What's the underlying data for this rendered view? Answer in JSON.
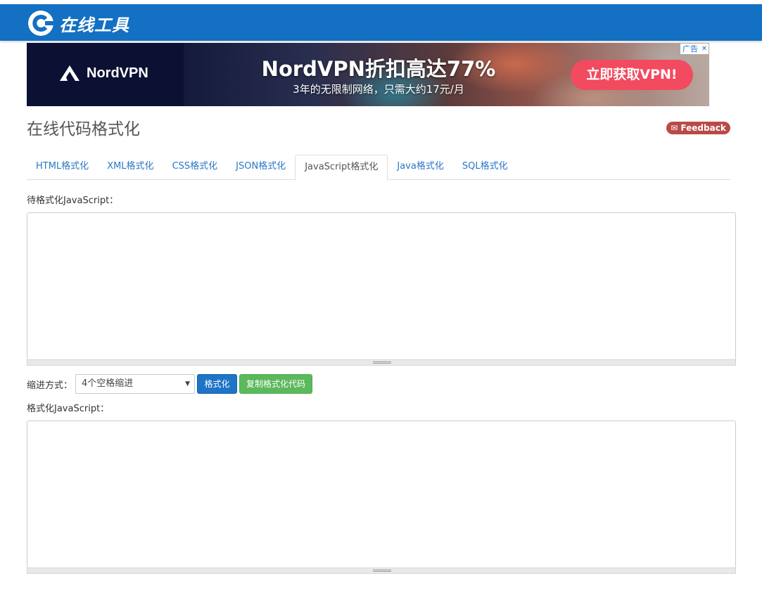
{
  "header": {
    "logo_text": "在线工具",
    "logo_icon": "c-logo-icon"
  },
  "ad": {
    "brand": "NordVPN",
    "headline": "NordVPN折扣高达77%",
    "subline": "3年的无限制网络，只需大约17元/月",
    "cta": "立即获取VPN!",
    "tag": "广告",
    "close": "✕"
  },
  "page": {
    "title": "在线代码格式化",
    "feedback_label": "✉ Feedback"
  },
  "tabs": [
    {
      "label": "HTML格式化",
      "active": false
    },
    {
      "label": "XML格式化",
      "active": false
    },
    {
      "label": "CSS格式化",
      "active": false
    },
    {
      "label": "JSON格式化",
      "active": false
    },
    {
      "label": "JavaScript格式化",
      "active": true
    },
    {
      "label": "Java格式化",
      "active": false
    },
    {
      "label": "SQL格式化",
      "active": false
    }
  ],
  "input": {
    "label": "待格式化JavaScript：",
    "value": ""
  },
  "controls": {
    "indent_label": "缩进方式：",
    "indent_selected": "4个空格缩进",
    "format_button": "格式化",
    "copy_button": "复制格式化代码"
  },
  "output": {
    "label": "格式化JavaScript：",
    "value": ""
  },
  "colors": {
    "header": "#1370c2",
    "accent_blue": "#1e74c6",
    "green": "#5cb85c",
    "feedback": "#b94a48",
    "ad_cta": "#f24a5e"
  }
}
